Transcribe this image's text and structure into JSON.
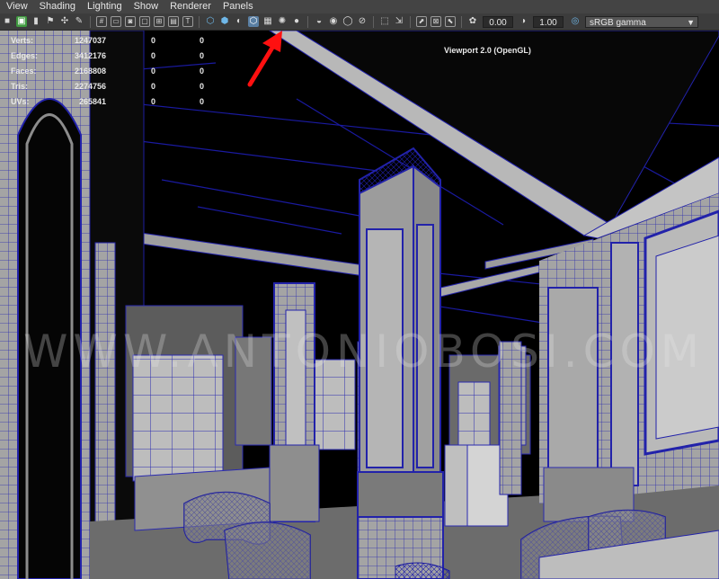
{
  "menu": [
    "View",
    "Shading",
    "Lighting",
    "Show",
    "Renderer",
    "Panels"
  ],
  "toolbar": {
    "exposure_value": "0.00",
    "gamma_value": "1.00",
    "color_space": "sRGB gamma",
    "colors": {
      "bar": "#3c3c3c",
      "menu": "#444444",
      "accent": "#5a7fa3"
    }
  },
  "hud": {
    "rows": [
      {
        "label": "Verts:",
        "value": "1247037",
        "a": "0",
        "b": "0"
      },
      {
        "label": "Edges:",
        "value": "3412176",
        "a": "0",
        "b": "0"
      },
      {
        "label": "Faces:",
        "value": "2168808",
        "a": "0",
        "b": "0"
      },
      {
        "label": "Tris:",
        "value": "2274756",
        "a": "0",
        "b": "0"
      },
      {
        "label": "UVs:",
        "value": "265841",
        "a": "0",
        "b": "0"
      }
    ]
  },
  "viewport": {
    "renderer_label": "Viewport 2.0 (OpenGL)",
    "watermark": "WWW.ANTONIOBOSI.COM",
    "annotation": "red-arrow-pointing-at-wireframe-on-shaded-button"
  }
}
